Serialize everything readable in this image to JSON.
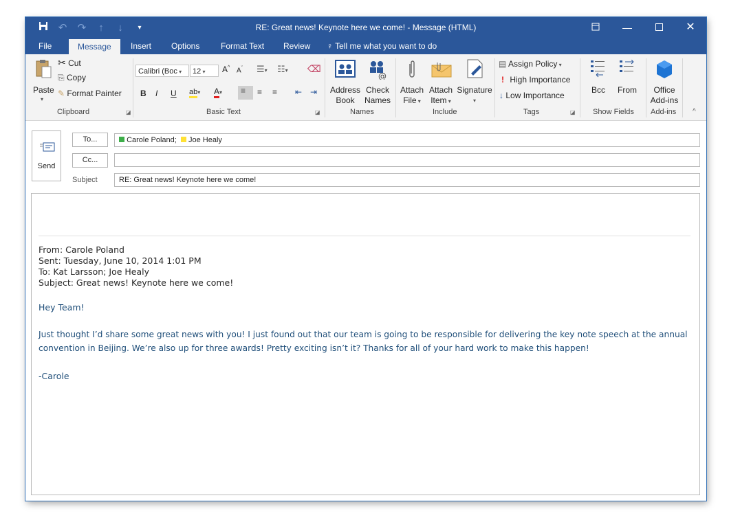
{
  "window": {
    "title": "RE: Great news! Keynote here we come! - Message (HTML)"
  },
  "tabs": [
    "File",
    "Message",
    "Insert",
    "Options",
    "Format Text",
    "Review"
  ],
  "tell_me": "Tell me what you want to do",
  "ribbon": {
    "clipboard": {
      "paste": "Paste",
      "cut": "Cut",
      "copy": "Copy",
      "format_painter": "Format Painter",
      "label": "Clipboard"
    },
    "basic_text": {
      "font": "Calibri (Boc",
      "size": "12",
      "bold": "B",
      "italic": "I",
      "underline": "U",
      "label": "Basic Text"
    },
    "names": {
      "address": "Address",
      "book": "Book",
      "check": "Check",
      "names_word": "Names",
      "label": "Names"
    },
    "include": {
      "attach": "Attach",
      "file": "File",
      "item": "Item",
      "signature": "Signature",
      "label": "Include"
    },
    "tags": {
      "assign_policy": "Assign Policy",
      "high": "High Importance",
      "low": "Low Importance",
      "label": "Tags"
    },
    "show_fields": {
      "bcc": "Bcc",
      "from": "From",
      "label": "Show Fields"
    },
    "addins": {
      "office": "Office",
      "addins_word": "Add-ins",
      "label": "Add-ins"
    }
  },
  "compose": {
    "send": "Send",
    "to_button": "To...",
    "cc_button": "Cc...",
    "subject_label": "Subject",
    "recipients": [
      {
        "name": "Carole Poland;",
        "color": "#3dae49"
      },
      {
        "name": "Joe Healy",
        "color": "#ffe135"
      }
    ],
    "cc_value": "",
    "subject_value": "RE: Great news! Keynote here we come!"
  },
  "message": {
    "from": "From: Carole Poland",
    "sent": "Sent: Tuesday, June 10, 2014 1:01 PM",
    "to": "To: Kat Larsson; Joe Healy",
    "subject": "Subject: Great news! Keynote here we come!",
    "greeting": "Hey Team!",
    "para_line1": "Just thought I’d share some great news with you! I just found out that our team is going to be responsible for delivering the key note speech at the annual",
    "para_line2": "convention in Beijing. We’re also up for three awards! Pretty exciting isn’t it? Thanks for all of your hard work to make this happen!",
    "signoff": "-Carole"
  },
  "colors": {
    "accent": "#2b579a",
    "body_text": "#1f4e79"
  }
}
